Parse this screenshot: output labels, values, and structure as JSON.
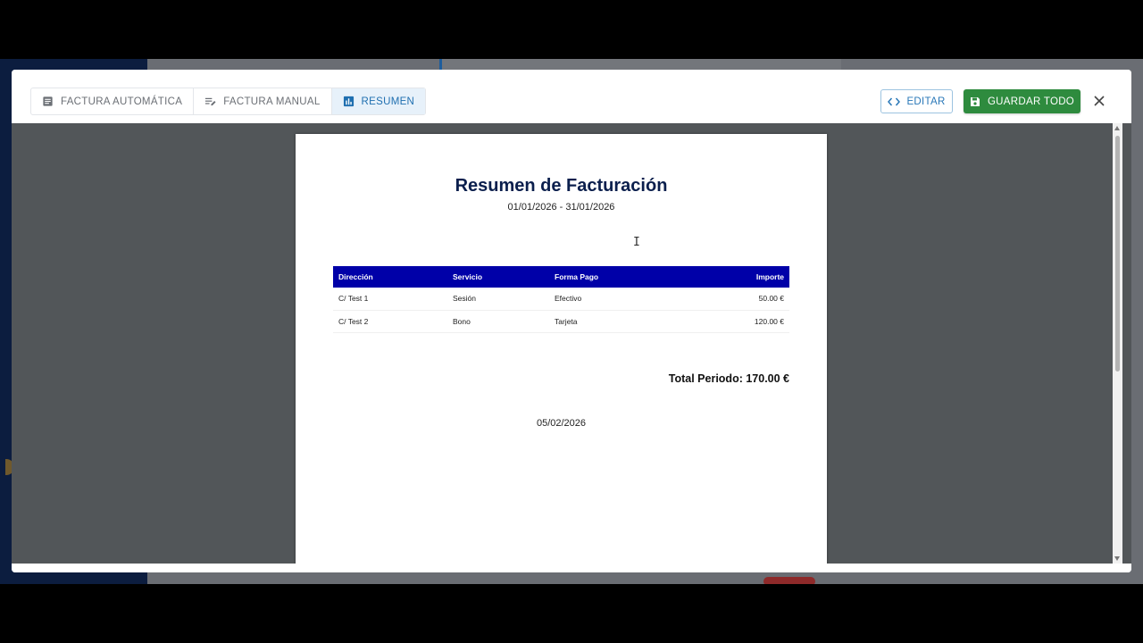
{
  "header": {
    "tabs": [
      {
        "label": "FACTURA AUTOMÁTICA",
        "icon": "document-list-icon",
        "active": false
      },
      {
        "label": "FACTURA MANUAL",
        "icon": "edit-notes-icon",
        "active": false
      },
      {
        "label": "RESUMEN",
        "icon": "bar-chart-icon",
        "active": true
      }
    ],
    "edit_label": "EDITAR",
    "save_label": "GUARDAR TODO",
    "close_icon": "close-icon"
  },
  "document": {
    "title": "Resumen de Facturación",
    "period": "01/01/2026 - 31/01/2026",
    "columns": [
      "Dirección",
      "Servicio",
      "Forma Pago",
      "Importe"
    ],
    "rows": [
      {
        "direccion": "C/ Test 1",
        "servicio": "Sesión",
        "forma_pago": "Efectivo",
        "importe": "50.00 €"
      },
      {
        "direccion": "C/ Test 2",
        "servicio": "Bono",
        "forma_pago": "Tarjeta",
        "importe": "120.00 €"
      }
    ],
    "total": "Total Periodo: 170.00 €",
    "date": "05/02/2026"
  },
  "colors": {
    "table_header": "#0000a8",
    "title": "#0b1f4d",
    "save_button": "#2e8b3e",
    "accent": "#1f6fb0"
  }
}
